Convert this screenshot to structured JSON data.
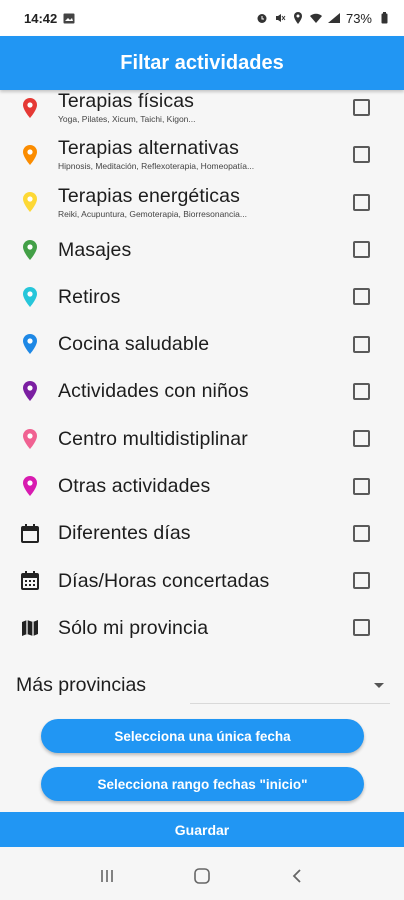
{
  "status_bar": {
    "time": "14:42",
    "battery": "73%",
    "left_icons": [
      "gallery-icon"
    ],
    "right_icons": [
      "alarm-icon",
      "mute-icon",
      "location-icon",
      "wifi-icon",
      "signal-icon",
      "battery-icon"
    ]
  },
  "app_bar": {
    "title": "Filtar actividades",
    "color": "#2196f3"
  },
  "filters": [
    {
      "icon": "map-pin-icon",
      "color": "#e53935",
      "label": "Terapias físicas",
      "subtitle": "Yoga, Pilates, Xicum, Taichi, Kigon...",
      "checked": false
    },
    {
      "icon": "map-pin-icon",
      "color": "#fb8c00",
      "label": "Terapias alternativas",
      "subtitle": "Hipnosis, Meditación, Reflexoterapia, Homeopatía...",
      "checked": false
    },
    {
      "icon": "map-pin-icon",
      "color": "#fdd835",
      "label": "Terapias energéticas",
      "subtitle": "Reiki, Acupuntura, Gemoterapia, Biorresonancia...",
      "checked": false
    },
    {
      "icon": "map-pin-icon",
      "color": "#43a047",
      "label": "Masajes",
      "subtitle": "",
      "checked": false
    },
    {
      "icon": "map-pin-icon",
      "color": "#26c6da",
      "label": "Retiros",
      "subtitle": "",
      "checked": false
    },
    {
      "icon": "map-pin-icon",
      "color": "#1e88e5",
      "label": "Cocina saludable",
      "subtitle": "",
      "checked": false
    },
    {
      "icon": "map-pin-icon",
      "color": "#7b1fa2",
      "label": "Actividades con niños",
      "subtitle": "",
      "checked": false
    },
    {
      "icon": "map-pin-icon",
      "color": "#f06292",
      "label": "Centro multidistiplinar",
      "subtitle": "",
      "checked": false
    },
    {
      "icon": "map-pin-icon",
      "color": "#d81bb0",
      "label": "Otras actividades",
      "subtitle": "",
      "checked": false
    },
    {
      "icon": "calendar-icon",
      "color": "#222222",
      "label": "Diferentes días",
      "subtitle": "",
      "checked": false
    },
    {
      "icon": "calendar-grid-icon",
      "color": "#222222",
      "label": "Días/Horas concertadas",
      "subtitle": "",
      "checked": false
    },
    {
      "icon": "map-icon",
      "color": "#222222",
      "label": "Sólo mi provincia",
      "subtitle": "",
      "checked": false
    }
  ],
  "province": {
    "label": "Más provincias",
    "selected": ""
  },
  "buttons": {
    "single_date": "Selecciona una única fecha",
    "date_range": "Selecciona rango fechas \"inicio\"",
    "save": "Guardar"
  },
  "nav_bar": {
    "icons": [
      "recent-apps-icon",
      "home-icon",
      "back-icon"
    ]
  }
}
